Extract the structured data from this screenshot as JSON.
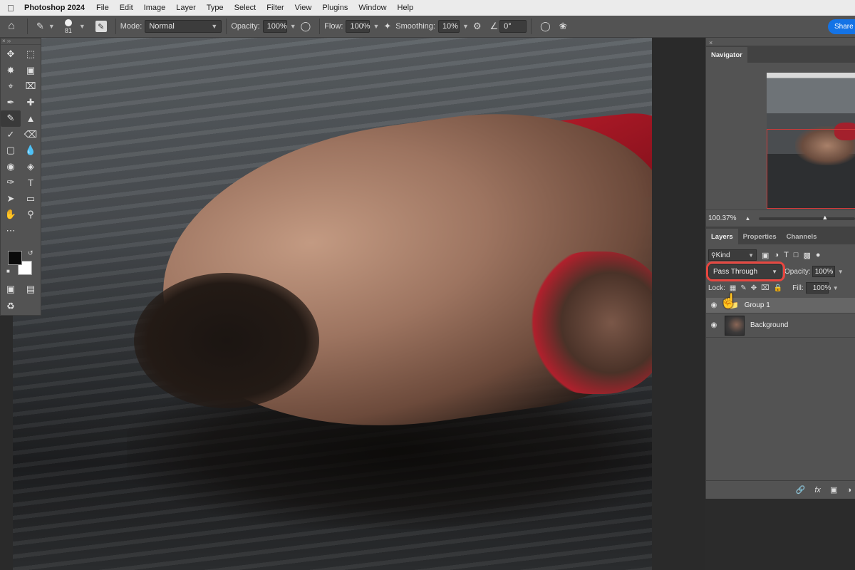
{
  "menubar": {
    "app_name": "Photoshop 2024",
    "items": [
      "File",
      "Edit",
      "Image",
      "Layer",
      "Type",
      "Select",
      "Filter",
      "View",
      "Plugins",
      "Window",
      "Help"
    ]
  },
  "options_bar": {
    "brush_size": "81",
    "mode_label": "Mode:",
    "mode_value": "Normal",
    "opacity_label": "Opacity:",
    "opacity_value": "100%",
    "flow_label": "Flow:",
    "flow_value": "100%",
    "smoothing_label": "Smoothing:",
    "smoothing_value": "10%",
    "angle_value": "0°",
    "share_label": "Share"
  },
  "navigator": {
    "tab": "Navigator",
    "zoom": "100.37%"
  },
  "layers_panel": {
    "tabs": [
      "Layers",
      "Properties",
      "Channels"
    ],
    "kind_label": "Kind",
    "blend_mode": "Pass Through",
    "opacity_label": "Opacity:",
    "opacity_value": "100%",
    "lock_label": "Lock:",
    "fill_label": "Fill:",
    "fill_value": "100%",
    "layers": [
      {
        "name": "Group 1"
      },
      {
        "name": "Background"
      }
    ]
  },
  "colors": {
    "accent": "#1473e6",
    "highlight": "#e8463f",
    "foreground_swatch": "#0a0a0a",
    "background_swatch": "#ffffff"
  }
}
